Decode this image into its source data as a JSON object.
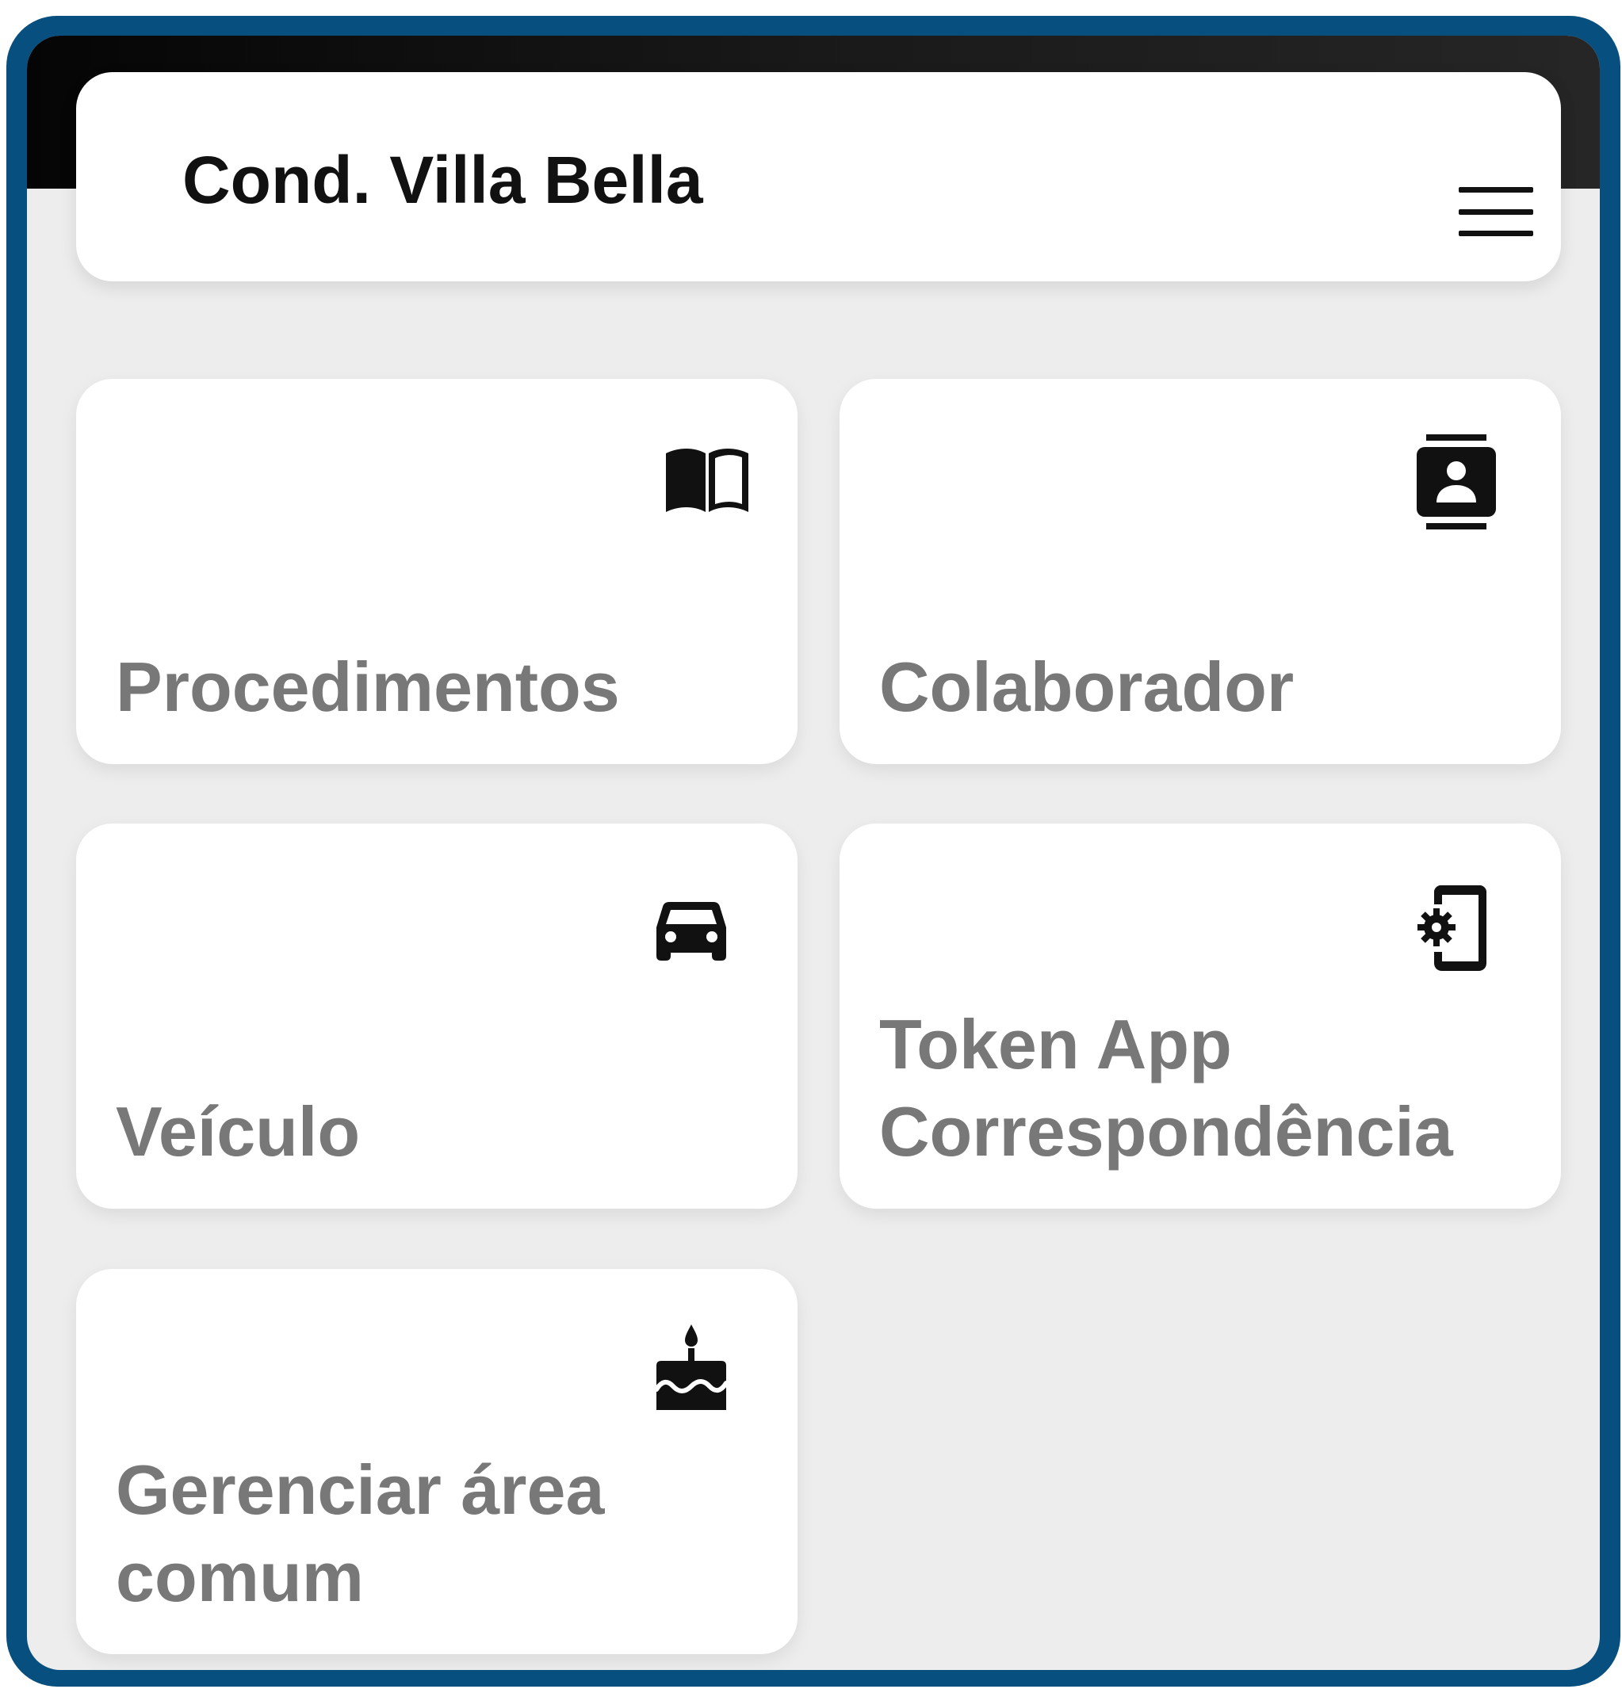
{
  "app_bar": {
    "title": "Cond. Villa Bella",
    "menu_icon": "hamburger-menu-icon"
  },
  "tiles": [
    {
      "label": "Procedimentos",
      "icon": "book-open-icon"
    },
    {
      "label": "Colaborador",
      "icon": "contact-badge-icon"
    },
    {
      "label": "Veículo",
      "icon": "car-icon"
    },
    {
      "label": "Token App\nCorrespondência",
      "icon": "phone-settings-icon"
    },
    {
      "label": "Gerenciar área\ncomum",
      "icon": "cake-icon"
    }
  ],
  "colors": {
    "frame": "#074f7e",
    "background": "#ededed",
    "card": "#ffffff",
    "label_text": "#787878",
    "title_text": "#111111"
  }
}
